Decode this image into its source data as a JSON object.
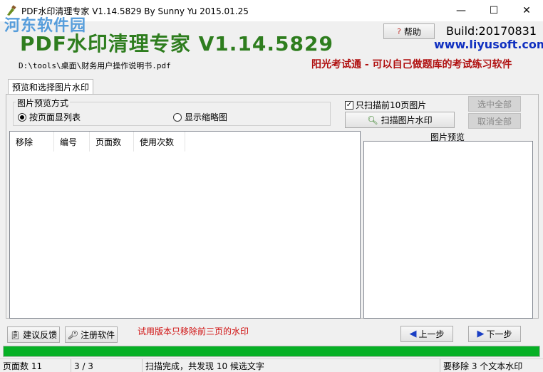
{
  "window": {
    "title": "PDF水印清理专家 V1.14.5829 By Sunny Yu 2015.01.25",
    "min_glyph": "—",
    "max_glyph": "☐",
    "close_glyph": "✕"
  },
  "watermark": {
    "text": "河东软件园"
  },
  "header": {
    "app_title": "PDF水印清理专家 V1.14.5829",
    "help_label": "帮助",
    "build": "Build:20170831",
    "site": "www.liyusoft.com",
    "file_path": "D:\\tools\\桌面\\财务用户操作说明书.pdf",
    "ad": "阳光考试通 - 可以自己做题库的考试练习软件"
  },
  "tab": {
    "label": "预览和选择图片水印"
  },
  "preview_mode": {
    "label": "图片预览方式",
    "options": [
      {
        "label": "按页面显列表",
        "selected": true
      },
      {
        "label": "显示缩略图",
        "selected": false
      }
    ]
  },
  "scan": {
    "only_first_label": "只扫描前10页图片",
    "only_first_checked": true,
    "scan_button": "扫描图片水印",
    "select_all": "选中全部",
    "deselect_all": "取消全部"
  },
  "table": {
    "columns": [
      "移除",
      "编号",
      "页面数",
      "使用次数"
    ],
    "rows": []
  },
  "preview": {
    "label": "图片预览"
  },
  "footer": {
    "feedback": "建议反馈",
    "register": "注册软件",
    "trial_note": "试用版本只移除前三页的水印",
    "prev": "上一步",
    "next": "下一步"
  },
  "progress": {
    "percent": 100,
    "color": "#06b025"
  },
  "status": {
    "pages": "页面数 11",
    "page_of": "3 / 3",
    "message": "扫描完成，共发现 10 候选文字",
    "removed": "要移除 3 个文本水印"
  },
  "colors": {
    "title_green": "#2e7d1e",
    "link_blue": "#1030c0",
    "ad_red": "#b01010",
    "trial_red": "#d01010"
  },
  "icons": [
    "app-icon",
    "help-icon",
    "search-icon",
    "feedback-icon",
    "key-icon",
    "arrow-left-icon",
    "arrow-right-icon"
  ]
}
